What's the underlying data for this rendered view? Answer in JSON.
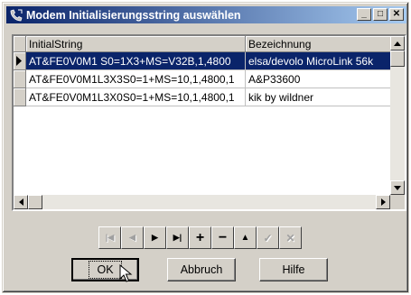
{
  "window": {
    "title": "Modem Initialisierungsstring auswählen",
    "controls": [
      "_",
      "□",
      "✕"
    ]
  },
  "grid": {
    "columns": [
      "InitialString",
      "Bezeichnung"
    ],
    "rows": [
      {
        "initial": "AT&FE0V0M1 S0=1X3+MS=V32B,1,4800",
        "name": "elsa/devolo MicroLink 56k",
        "selected": true
      },
      {
        "initial": "AT&FE0V0M1L3X3S0=1+MS=10,1,4800,1",
        "name": "A&P33600",
        "selected": false
      },
      {
        "initial": "AT&FE0V0M1L3X0S0=1+MS=10,1,4800,1",
        "name": "kik by wildner",
        "selected": false
      }
    ]
  },
  "navigator": {
    "buttons": [
      {
        "name": "first",
        "glyph": "|◀",
        "enabled": false
      },
      {
        "name": "prior",
        "glyph": "◀",
        "enabled": false
      },
      {
        "name": "next",
        "glyph": "▶",
        "enabled": true
      },
      {
        "name": "last",
        "glyph": "▶|",
        "enabled": true
      },
      {
        "name": "insert",
        "glyph": "+",
        "enabled": true
      },
      {
        "name": "delete",
        "glyph": "−",
        "enabled": true
      },
      {
        "name": "edit",
        "glyph": "▲",
        "enabled": true
      },
      {
        "name": "post",
        "glyph": "✓",
        "enabled": false
      },
      {
        "name": "cancel",
        "glyph": "✕",
        "enabled": false
      }
    ]
  },
  "buttons": {
    "ok": "OK",
    "cancel": "Abbruch",
    "help": "Hilfe"
  }
}
